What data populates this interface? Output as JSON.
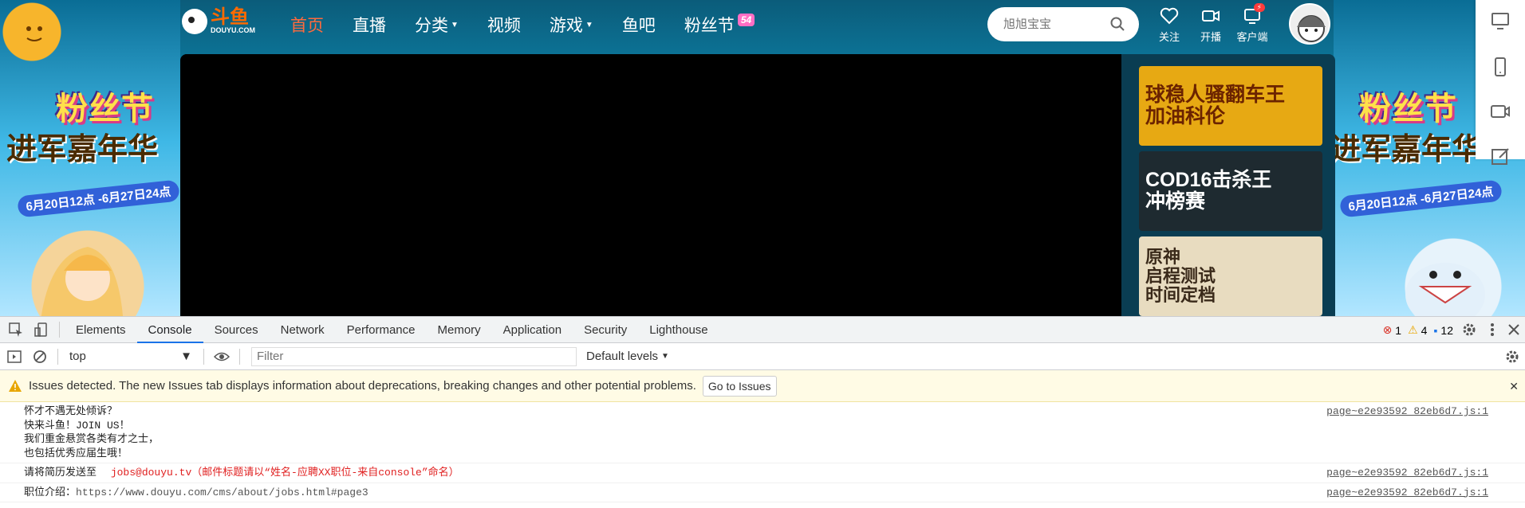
{
  "site": {
    "logo": {
      "cn": "斗鱼",
      "en": "DOUYU.COM"
    },
    "nav": [
      {
        "label": "首页",
        "active": true,
        "caret": false
      },
      {
        "label": "直播",
        "active": false,
        "caret": false
      },
      {
        "label": "分类",
        "active": false,
        "caret": true
      },
      {
        "label": "视频",
        "active": false,
        "caret": false
      },
      {
        "label": "游戏",
        "active": false,
        "caret": true
      },
      {
        "label": "鱼吧",
        "active": false,
        "caret": false
      },
      {
        "label": "粉丝节",
        "active": false,
        "caret": false,
        "badge": "54"
      }
    ],
    "search": {
      "placeholder": "旭旭宝宝"
    },
    "actions": [
      {
        "label": "关注",
        "icon": "heart-icon"
      },
      {
        "label": "开播",
        "icon": "camera-icon"
      },
      {
        "label": "客户端",
        "icon": "download-icon"
      }
    ],
    "festival": {
      "title": "粉丝节",
      "title_badge": "54",
      "subtitle": "进军嘉年华",
      "date": "6月20日12点 -6月27日24点"
    },
    "promos": [
      {
        "text": "球稳人骚翻车王\n加油科伦",
        "bg": "#e7a913",
        "color": "#6b2300"
      },
      {
        "text": "COD16击杀王\n冲榜赛",
        "bg": "#1e2a30",
        "color": "#ffffff"
      },
      {
        "text": "原神\n启程测试\n时间定档",
        "bg": "#e8dcc0",
        "color": "#3a2a1a"
      }
    ],
    "colors": {
      "accent": "#ff6a3d",
      "brand": "#ff6a00"
    }
  },
  "devtools": {
    "tabs": [
      "Elements",
      "Console",
      "Sources",
      "Network",
      "Performance",
      "Memory",
      "Application",
      "Security",
      "Lighthouse"
    ],
    "active_tab": "Console",
    "counts": {
      "errors": "1",
      "warnings": "4",
      "messages": "12"
    },
    "context": "top",
    "filter_placeholder": "Filter",
    "levels": "Default levels",
    "issues_text": "Issues detected. The new Issues tab displays information about deprecations, breaking changes and other potential problems.",
    "issues_button": "Go to Issues",
    "logs": [
      {
        "lines": [
          "怀才不遇无处倾诉？",
          "快来斗鱼！JOIN US！",
          "我们重金悬赏各类有才之士，",
          "也包括优秀应届生哦！"
        ],
        "source": "page~e2e93592_82eb6d7.js:1"
      },
      {
        "prefix": "请将简历发送至",
        "red": "jobs@douyu.tv（邮件标题请以“姓名-应聘XX职位-来自console”命名）",
        "source": "page~e2e93592_82eb6d7.js:1"
      },
      {
        "prefix": "职位介绍：",
        "link": "https://www.douyu.com/cms/about/jobs.html#page3",
        "source": "page~e2e93592_82eb6d7.js:1"
      }
    ]
  }
}
